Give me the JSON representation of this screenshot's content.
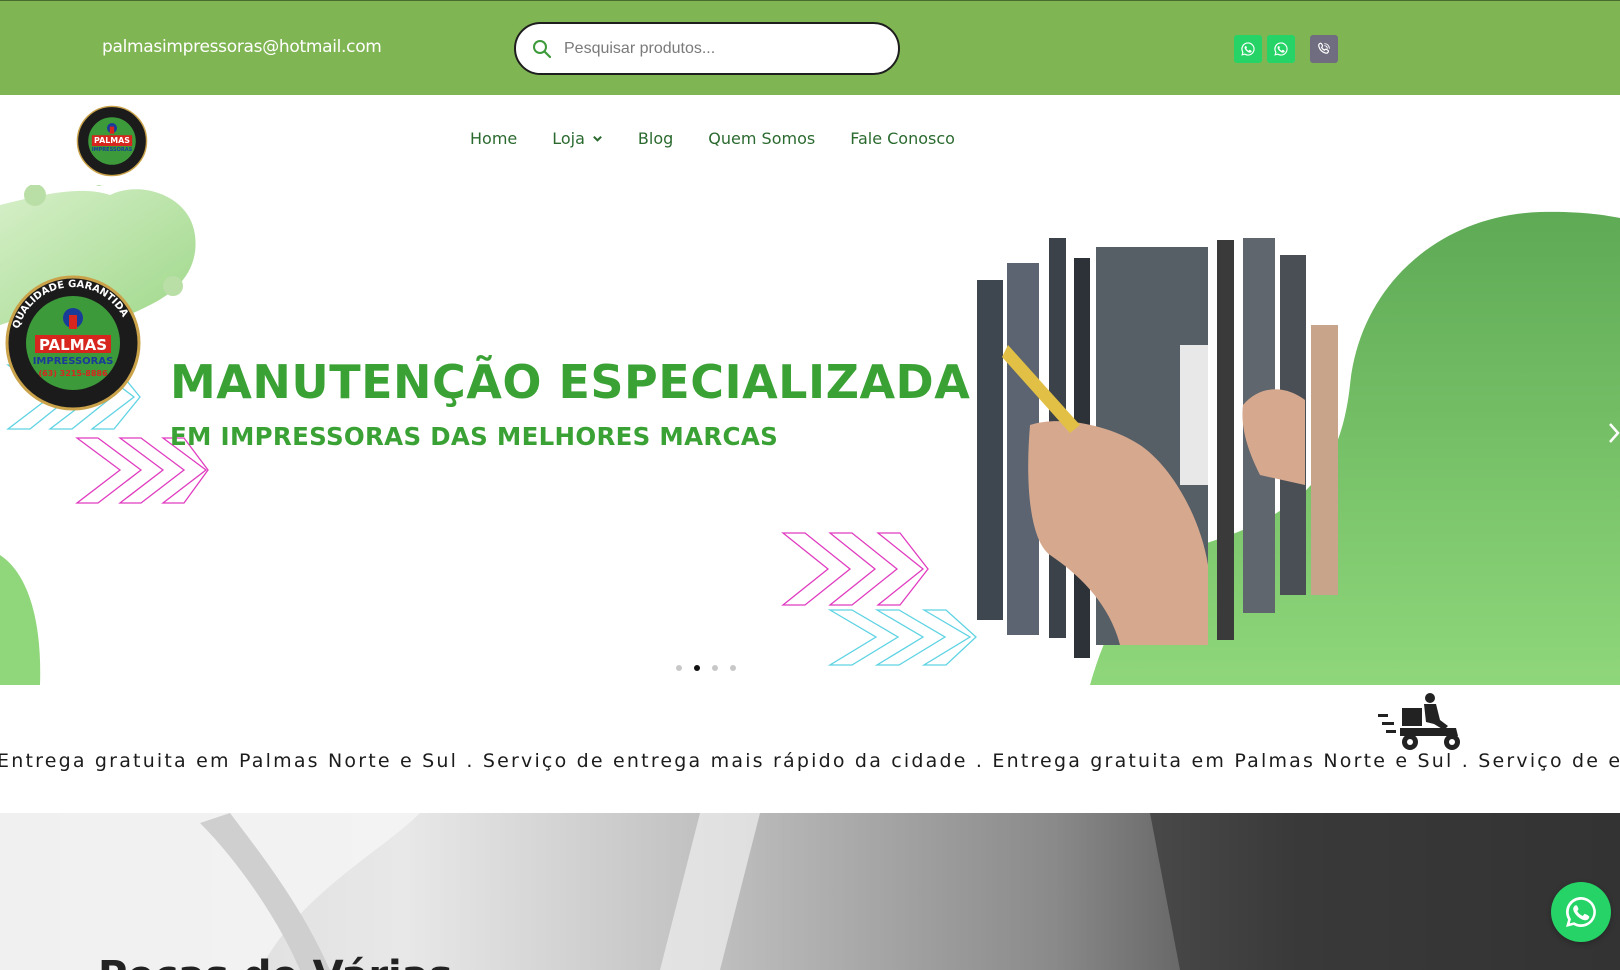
{
  "topbar": {
    "email": "palmasimpressoras@hotmail.com",
    "search_placeholder": "Pesquisar produtos...",
    "social": [
      {
        "icon": "whatsapp-icon",
        "color": "#25d366"
      },
      {
        "icon": "whatsapp-icon",
        "color": "#25d366"
      },
      {
        "icon": "viber-phone-icon",
        "color": "#6f6d7f"
      }
    ]
  },
  "logo": {
    "ring_text": "QUALIDADE GARANTIDA",
    "name": "PALMAS",
    "sub": "IMPRESSORAS",
    "phone": "(63) 3215-8886"
  },
  "nav": {
    "items": [
      {
        "label": "Home"
      },
      {
        "label": "Loja",
        "has_dropdown": true
      },
      {
        "label": "Blog"
      },
      {
        "label": "Quem Somos"
      },
      {
        "label": "Fale Conosco"
      }
    ]
  },
  "hero": {
    "title": "MANUTENÇÃO ESPECIALIZADA",
    "subtitle": "EM IMPRESSORAS DAS MELHORES MARCAS",
    "slides_count": 4,
    "active_slide": 2,
    "brand_green": "#3aa135"
  },
  "delivery": {
    "text": "Entrega gratuita em Palmas Norte e Sul . Serviço de entrega mais rápido da cidade . Entrega gratuita em Palmas Norte e Sul . Serviço de entrega mais rápido da cidade . "
  },
  "lower": {
    "heading": "Peças de Várias"
  },
  "colors": {
    "topbar": "#80b554",
    "nav_text": "#2b6a2f",
    "whatsapp": "#25d366"
  }
}
